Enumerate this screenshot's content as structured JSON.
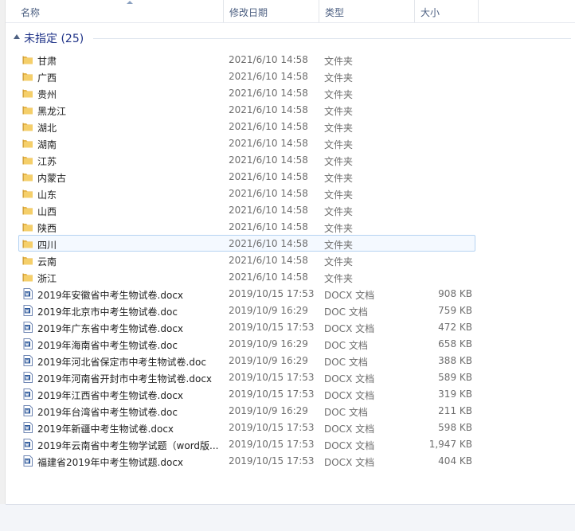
{
  "columns": [
    {
      "name": "col-name",
      "label": "名称"
    },
    {
      "name": "col-date",
      "label": "修改日期"
    },
    {
      "name": "col-type",
      "label": "类型"
    },
    {
      "name": "col-size",
      "label": "大小"
    }
  ],
  "group": {
    "label": "未指定 (25)"
  },
  "colors": {
    "accent": "#1e3287",
    "header_text": "#4d6082",
    "folder": "#e8b64a",
    "doc_icon": "#2b579a",
    "hover_bg": "#f4f9ff",
    "hover_border": "#b5d3f2"
  },
  "files": [
    {
      "name": "甘肃",
      "date": "2021/6/10 14:58",
      "type": "文件夹",
      "size": "",
      "icon": "folder-icon"
    },
    {
      "name": "广西",
      "date": "2021/6/10 14:58",
      "type": "文件夹",
      "size": "",
      "icon": "folder-icon"
    },
    {
      "name": "贵州",
      "date": "2021/6/10 14:58",
      "type": "文件夹",
      "size": "",
      "icon": "folder-icon"
    },
    {
      "name": "黑龙江",
      "date": "2021/6/10 14:58",
      "type": "文件夹",
      "size": "",
      "icon": "folder-icon"
    },
    {
      "name": "湖北",
      "date": "2021/6/10 14:58",
      "type": "文件夹",
      "size": "",
      "icon": "folder-icon"
    },
    {
      "name": "湖南",
      "date": "2021/6/10 14:58",
      "type": "文件夹",
      "size": "",
      "icon": "folder-icon"
    },
    {
      "name": "江苏",
      "date": "2021/6/10 14:58",
      "type": "文件夹",
      "size": "",
      "icon": "folder-icon"
    },
    {
      "name": "内蒙古",
      "date": "2021/6/10 14:58",
      "type": "文件夹",
      "size": "",
      "icon": "folder-icon"
    },
    {
      "name": "山东",
      "date": "2021/6/10 14:58",
      "type": "文件夹",
      "size": "",
      "icon": "folder-icon"
    },
    {
      "name": "山西",
      "date": "2021/6/10 14:58",
      "type": "文件夹",
      "size": "",
      "icon": "folder-icon"
    },
    {
      "name": "陕西",
      "date": "2021/6/10 14:58",
      "type": "文件夹",
      "size": "",
      "icon": "folder-icon"
    },
    {
      "name": "四川",
      "date": "2021/6/10 14:58",
      "type": "文件夹",
      "size": "",
      "icon": "folder-icon",
      "hover": true
    },
    {
      "name": "云南",
      "date": "2021/6/10 14:58",
      "type": "文件夹",
      "size": "",
      "icon": "folder-icon"
    },
    {
      "name": "浙江",
      "date": "2021/6/10 14:58",
      "type": "文件夹",
      "size": "",
      "icon": "folder-icon"
    },
    {
      "name": "2019年安徽省中考生物试卷.docx",
      "date": "2019/10/15 17:53",
      "type": "DOCX 文档",
      "size": "908 KB",
      "icon": "word-doc-icon"
    },
    {
      "name": "2019年北京市中考生物试卷.doc",
      "date": "2019/10/9 16:29",
      "type": "DOC 文档",
      "size": "759 KB",
      "icon": "word-doc-icon"
    },
    {
      "name": "2019年广东省中考生物试卷.docx",
      "date": "2019/10/15 17:53",
      "type": "DOCX 文档",
      "size": "472 KB",
      "icon": "word-doc-icon"
    },
    {
      "name": "2019年海南省中考生物试卷.doc",
      "date": "2019/10/9 16:29",
      "type": "DOC 文档",
      "size": "658 KB",
      "icon": "word-doc-icon"
    },
    {
      "name": "2019年河北省保定市中考生物试卷.doc",
      "date": "2019/10/9 16:29",
      "type": "DOC 文档",
      "size": "388 KB",
      "icon": "word-doc-icon"
    },
    {
      "name": "2019年河南省开封市中考生物试卷.docx",
      "date": "2019/10/15 17:53",
      "type": "DOCX 文档",
      "size": "589 KB",
      "icon": "word-doc-icon"
    },
    {
      "name": "2019年江西省中考生物试卷.docx",
      "date": "2019/10/15 17:53",
      "type": "DOCX 文档",
      "size": "319 KB",
      "icon": "word-doc-icon"
    },
    {
      "name": "2019年台湾省中考生物试卷.doc",
      "date": "2019/10/9 16:29",
      "type": "DOC 文档",
      "size": "211 KB",
      "icon": "word-doc-icon"
    },
    {
      "name": "2019年新疆中考生物试卷.docx",
      "date": "2019/10/15 17:53",
      "type": "DOCX 文档",
      "size": "598 KB",
      "icon": "word-doc-icon"
    },
    {
      "name": "2019年云南省中考生物学试题（word版...",
      "date": "2019/10/15 17:53",
      "type": "DOCX 文档",
      "size": "1,947 KB",
      "icon": "word-doc-icon"
    },
    {
      "name": "福建省2019年中考生物试题.docx",
      "date": "2019/10/15 17:53",
      "type": "DOCX 文档",
      "size": "404 KB",
      "icon": "word-doc-icon"
    }
  ]
}
